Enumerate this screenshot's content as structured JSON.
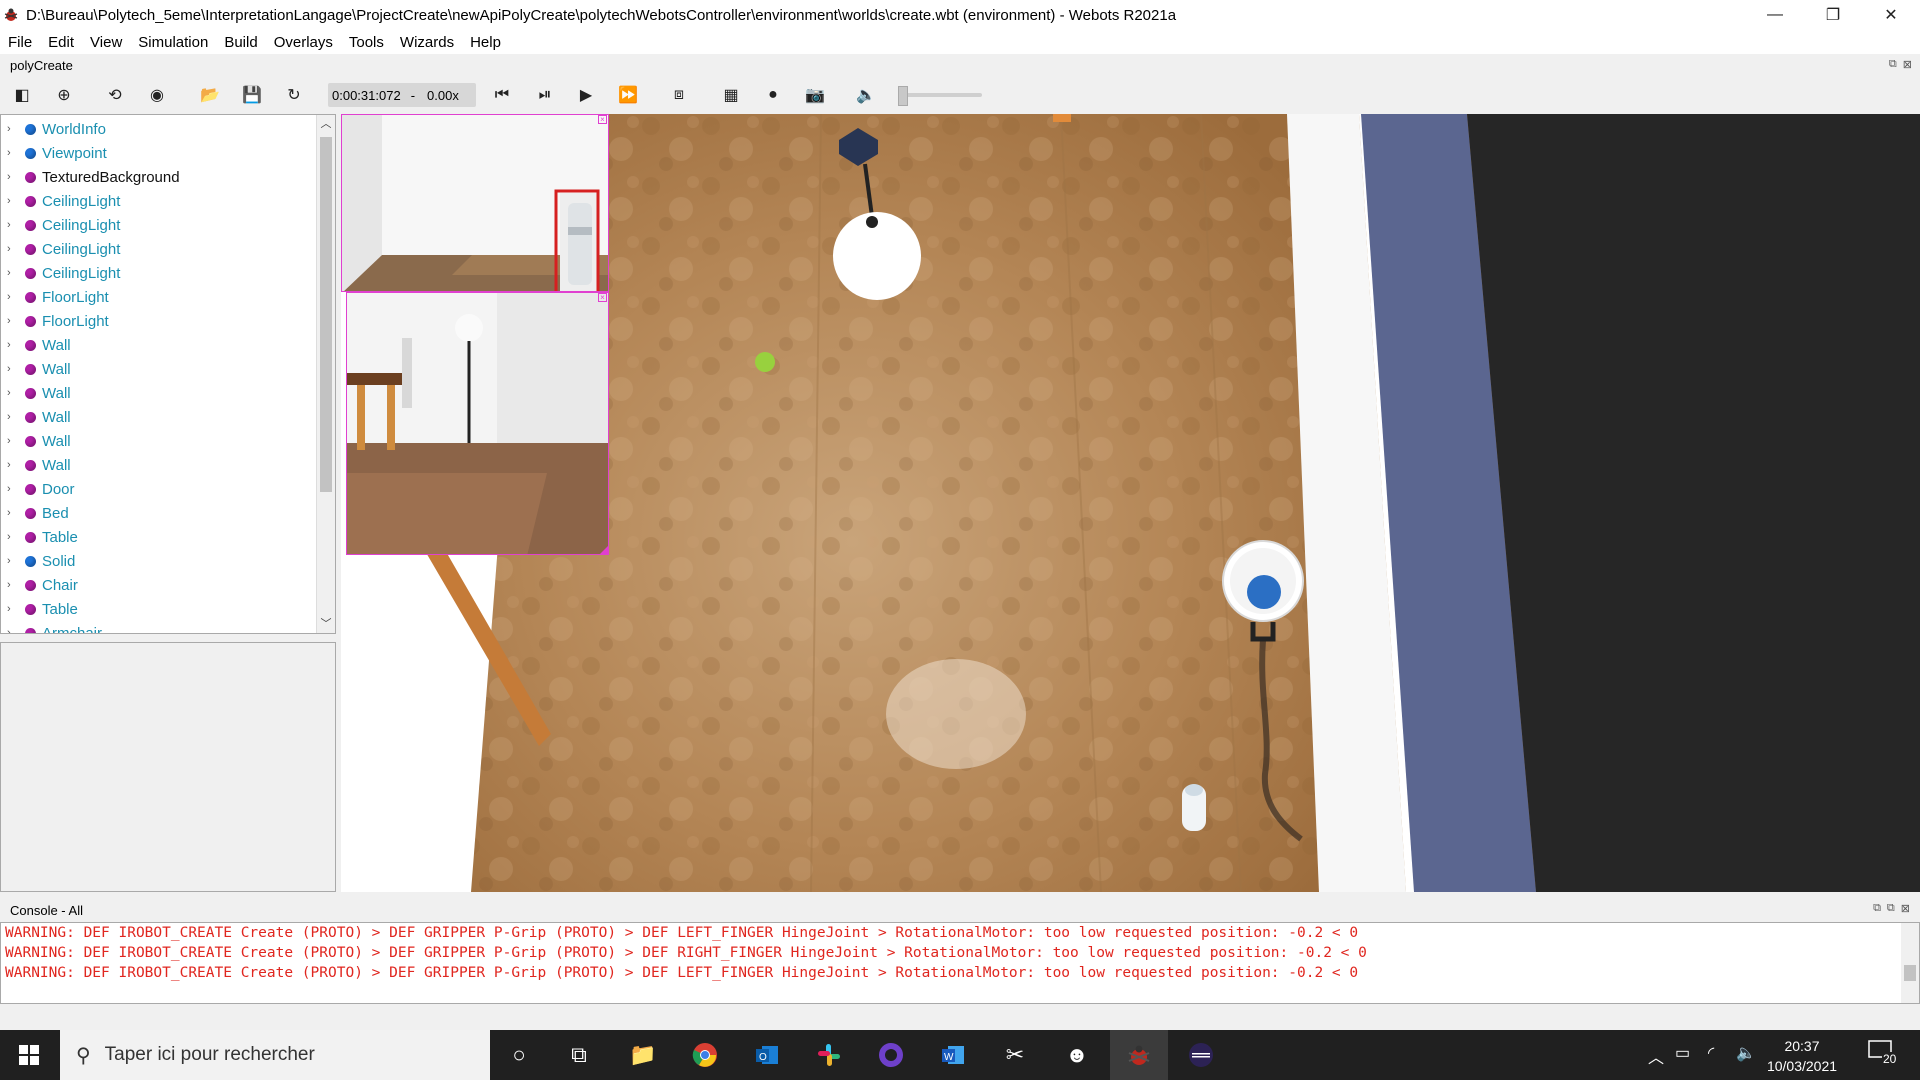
{
  "window": {
    "title": "D:\\Bureau\\Polytech_5eme\\InterpretationLangage\\ProjectCreate\\newApiPolyCreate\\polytechWebotsController\\environment\\worlds\\create.wbt (environment) - Webots R2021a",
    "minimize": "—",
    "maximize": "❐",
    "close": "✕"
  },
  "menu": [
    "File",
    "Edit",
    "View",
    "Simulation",
    "Build",
    "Overlays",
    "Tools",
    "Wizards",
    "Help"
  ],
  "world_name": "polyCreate",
  "toolbar": {
    "time": "0:00:31:072",
    "separator": "-",
    "speed": "0.00x"
  },
  "scene_tree": [
    {
      "label": "WorldInfo",
      "color": "#1e73d8",
      "dark": false
    },
    {
      "label": "Viewpoint",
      "color": "#1e73d8",
      "dark": false
    },
    {
      "label": "TexturedBackground",
      "color": "#b01fa6",
      "dark": true
    },
    {
      "label": "CeilingLight",
      "color": "#b01fa6",
      "dark": false
    },
    {
      "label": "CeilingLight",
      "color": "#b01fa6",
      "dark": false
    },
    {
      "label": "CeilingLight",
      "color": "#b01fa6",
      "dark": false
    },
    {
      "label": "CeilingLight",
      "color": "#b01fa6",
      "dark": false
    },
    {
      "label": "FloorLight",
      "color": "#b01fa6",
      "dark": false
    },
    {
      "label": "FloorLight",
      "color": "#b01fa6",
      "dark": false
    },
    {
      "label": "Wall",
      "color": "#b01fa6",
      "dark": false
    },
    {
      "label": "Wall",
      "color": "#b01fa6",
      "dark": false
    },
    {
      "label": "Wall",
      "color": "#b01fa6",
      "dark": false
    },
    {
      "label": "Wall",
      "color": "#b01fa6",
      "dark": false
    },
    {
      "label": "Wall",
      "color": "#b01fa6",
      "dark": false
    },
    {
      "label": "Wall",
      "color": "#b01fa6",
      "dark": false
    },
    {
      "label": "Door",
      "color": "#b01fa6",
      "dark": false
    },
    {
      "label": "Bed",
      "color": "#b01fa6",
      "dark": false
    },
    {
      "label": "Table",
      "color": "#b01fa6",
      "dark": false
    },
    {
      "label": "Solid",
      "color": "#1e73d8",
      "dark": false
    },
    {
      "label": "Chair",
      "color": "#b01fa6",
      "dark": false
    },
    {
      "label": "Table",
      "color": "#b01fa6",
      "dark": false
    },
    {
      "label": "Armchair",
      "color": "#b01fa6",
      "dark": false
    }
  ],
  "console": {
    "title": "Console - All",
    "lines": [
      "WARNING: DEF IROBOT_CREATE Create (PROTO) > DEF GRIPPER P-Grip (PROTO) > DEF LEFT_FINGER HingeJoint > RotationalMotor: too low requested position: -0.2 < 0",
      "WARNING: DEF IROBOT_CREATE Create (PROTO) > DEF GRIPPER P-Grip (PROTO) > DEF RIGHT_FINGER HingeJoint > RotationalMotor: too low requested position: -0.2 < 0",
      "WARNING: DEF IROBOT_CREATE Create (PROTO) > DEF GRIPPER P-Grip (PROTO) > DEF LEFT_FINGER HingeJoint > RotationalMotor: too low requested position: -0.2 < 0"
    ]
  },
  "taskbar": {
    "search_placeholder": "Taper ici pour rechercher",
    "time": "20:37",
    "date": "10/03/2021",
    "notification_count": "20"
  },
  "colors": {
    "node_blue": "#1e73d8",
    "node_purple": "#b01fa6",
    "console_warning": "#e0261f",
    "overlay_border": "#e040d0"
  }
}
